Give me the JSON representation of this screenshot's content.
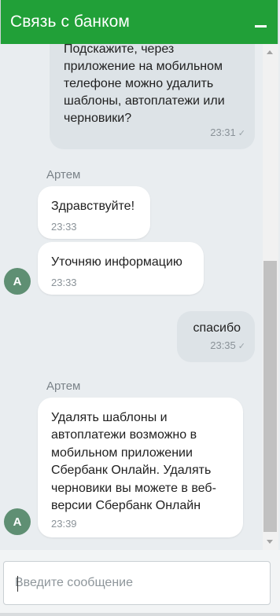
{
  "header": {
    "title": "Связь с банком",
    "minimize_icon": "minimize-icon"
  },
  "messages": [
    {
      "direction": "out",
      "text": "Подскажите, через приложение на мобильном телефоне можно удалить шаблоны, автоплатежи или черновики?",
      "time": "23:31",
      "status_icon": "check-icon"
    },
    {
      "direction": "in",
      "sender": "Артем",
      "text": "Здравствуйте!",
      "time": "23:33"
    },
    {
      "direction": "in",
      "text": "Уточняю информацию",
      "time": "23:33",
      "avatar": "A"
    },
    {
      "direction": "out",
      "text": "спасибо",
      "time": "23:35",
      "status_icon": "check-icon"
    },
    {
      "direction": "in",
      "sender": "Артем",
      "text": "Удалять шаблоны и автоплатежи возможно в мобильном приложении Сбербанк Онлайн. Удалять черновики вы можете в веб-версии Сбербанк Онлайн",
      "time": "23:39",
      "avatar": "A"
    }
  ],
  "composer": {
    "placeholder": "Введите сообщение",
    "value": ""
  },
  "colors": {
    "brand": "#21a038",
    "avatar": "#5f8f73",
    "outgoing_bubble": "#dde3e7",
    "incoming_bubble": "#ffffff"
  },
  "check_glyph": "✓"
}
